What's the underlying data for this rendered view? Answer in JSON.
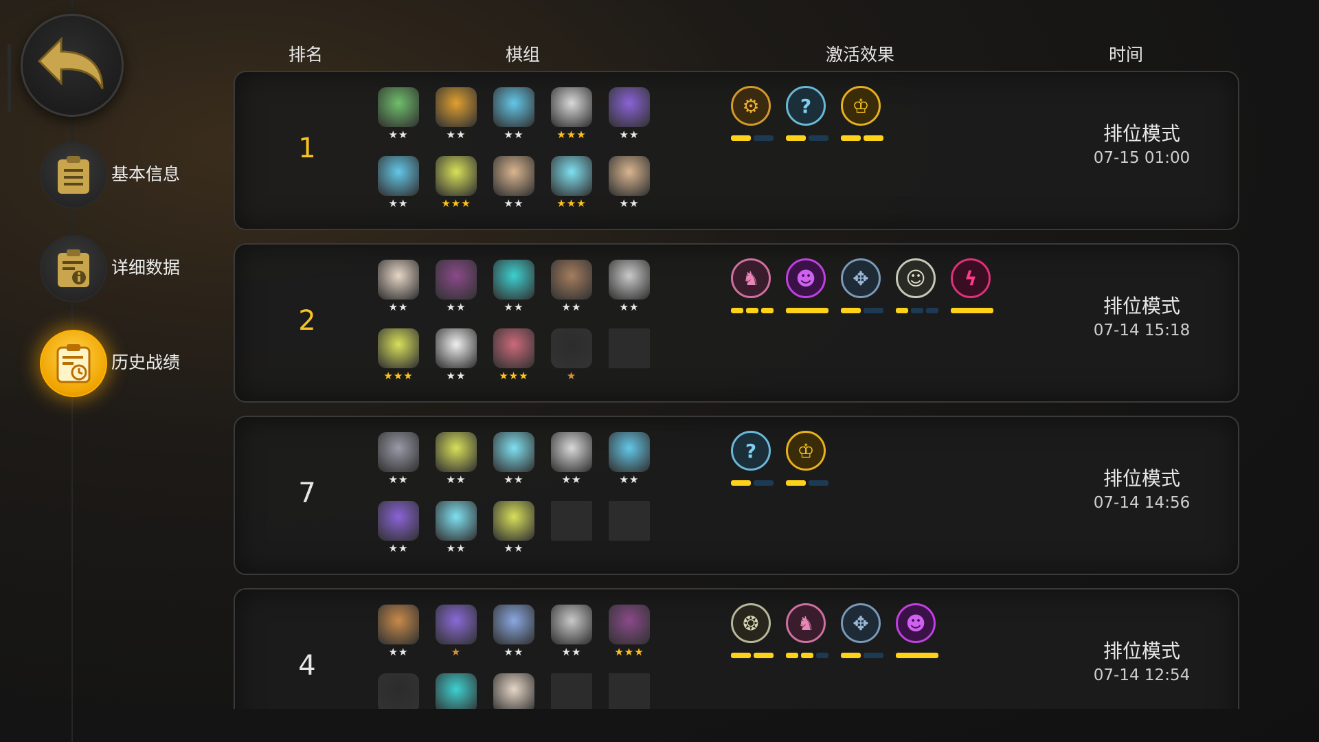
{
  "headers": {
    "rank": "排名",
    "team": "棋组",
    "effect": "激活效果",
    "time": "时间"
  },
  "nav": {
    "back_icon": "back-arrow-icon",
    "items": [
      {
        "label": "基本信息",
        "icon": "clipboard-list-icon",
        "active": false
      },
      {
        "label": "详细数据",
        "icon": "clipboard-info-icon",
        "active": false
      },
      {
        "label": "历史战绩",
        "icon": "clipboard-clock-icon",
        "active": true
      }
    ]
  },
  "rows": [
    {
      "rank": "1",
      "mode": "排位模式",
      "date": "07-15 01:00",
      "units": [
        {
          "color": "#6fbf6a",
          "stars": "★★",
          "tone": "s"
        },
        {
          "color": "#e0a030",
          "stars": "★★",
          "tone": "s"
        },
        {
          "color": "#63c7e8",
          "stars": "★★",
          "tone": "s"
        },
        {
          "color": "#d9d9d9",
          "stars": "★★★",
          "tone": "g"
        },
        {
          "color": "#8a63d8",
          "stars": "★★",
          "tone": "s"
        },
        {
          "color": "#63c7e8",
          "stars": "★★",
          "tone": "s"
        },
        {
          "color": "#d8e05a",
          "stars": "★★★",
          "tone": "g"
        },
        {
          "color": "#d9b58f",
          "stars": "★★",
          "tone": "s"
        },
        {
          "color": "#7fe0f0",
          "stars": "★★★",
          "tone": "g"
        },
        {
          "color": "#d9b58f",
          "stars": "★★",
          "tone": "s"
        }
      ],
      "effects": [
        {
          "glyph": "⚙",
          "ring": "#d39b2a",
          "fill": "#3a2a10",
          "text": "#f0b030",
          "bars": [
            1,
            0
          ]
        },
        {
          "glyph": "?",
          "ring": "#6ab8d8",
          "fill": "#1b2f3a",
          "text": "#7fd0f0",
          "bars": [
            1,
            0
          ]
        },
        {
          "glyph": "♔",
          "ring": "#e8b020",
          "fill": "#3a2c08",
          "text": "#ffcc20",
          "bars": [
            1,
            1
          ]
        }
      ]
    },
    {
      "rank": "2",
      "mode": "排位模式",
      "date": "07-14 15:18",
      "units": [
        {
          "color": "#e6d6c6",
          "stars": "★★",
          "tone": "s"
        },
        {
          "color": "#8a4a8a",
          "stars": "★★",
          "tone": "s"
        },
        {
          "color": "#3ed0d0",
          "stars": "★★",
          "tone": "s"
        },
        {
          "color": "#a57d5e",
          "stars": "★★",
          "tone": "s"
        },
        {
          "color": "#c9c9c9",
          "stars": "★★",
          "tone": "s"
        },
        {
          "color": "#d8e05a",
          "stars": "★★★",
          "tone": "g"
        },
        {
          "color": "#efefef",
          "stars": "★★",
          "tone": "s"
        },
        {
          "color": "#cc6a7a",
          "stars": "★★★",
          "tone": "g"
        },
        {
          "color": "#2c2c2c",
          "stars": "★",
          "tone": "o"
        },
        {
          "color": "",
          "stars": "",
          "tone": "s",
          "empty": true
        }
      ],
      "effects": [
        {
          "glyph": "♞",
          "ring": "#d070a0",
          "fill": "#3a1d2c",
          "text": "#e888b8",
          "bars": [
            1,
            1,
            1
          ]
        },
        {
          "glyph": "☻",
          "ring": "#c040e0",
          "fill": "#3a1248",
          "text": "#d060f0",
          "bars": [
            1
          ]
        },
        {
          "glyph": "✥",
          "ring": "#7a9ab8",
          "fill": "#1e2a36",
          "text": "#9ab8d8",
          "bars": [
            1,
            0
          ]
        },
        {
          "glyph": "☺",
          "ring": "#c8c8b8",
          "fill": "#2a2a24",
          "text": "#e0e0d0",
          "bars": [
            1,
            0,
            0
          ]
        },
        {
          "glyph": "ϟ",
          "ring": "#e0307a",
          "fill": "#3a0e22",
          "text": "#ff3a8a",
          "bars": [
            1
          ]
        }
      ]
    },
    {
      "rank": "7",
      "mode": "排位模式",
      "date": "07-14 14:56",
      "units": [
        {
          "color": "#9a9aa8",
          "stars": "★★",
          "tone": "s"
        },
        {
          "color": "#d8e05a",
          "stars": "★★",
          "tone": "s"
        },
        {
          "color": "#7fe0f0",
          "stars": "★★",
          "tone": "s"
        },
        {
          "color": "#d9d9d9",
          "stars": "★★",
          "tone": "s"
        },
        {
          "color": "#63c7e8",
          "stars": "★★",
          "tone": "s"
        },
        {
          "color": "#8a63d8",
          "stars": "★★",
          "tone": "s"
        },
        {
          "color": "#7fe0f0",
          "stars": "★★",
          "tone": "s"
        },
        {
          "color": "#d8e05a",
          "stars": "★★",
          "tone": "s"
        },
        {
          "color": "",
          "stars": "",
          "tone": "s",
          "empty": true
        },
        {
          "color": "",
          "stars": "",
          "tone": "s",
          "empty": true
        }
      ],
      "effects": [
        {
          "glyph": "?",
          "ring": "#6ab8d8",
          "fill": "#1b2f3a",
          "text": "#7fd0f0",
          "bars": [
            1,
            0
          ]
        },
        {
          "glyph": "♔",
          "ring": "#e8b020",
          "fill": "#3a2c08",
          "text": "#ffcc20",
          "bars": [
            1,
            0
          ]
        }
      ]
    },
    {
      "rank": "4",
      "mode": "排位模式",
      "date": "07-14 12:54",
      "units": [
        {
          "color": "#c98a4a",
          "stars": "★★",
          "tone": "s"
        },
        {
          "color": "#8a6ad8",
          "stars": "★",
          "tone": "o"
        },
        {
          "color": "#8aa8e0",
          "stars": "★★",
          "tone": "s"
        },
        {
          "color": "#c9c9c9",
          "stars": "★★",
          "tone": "s"
        },
        {
          "color": "#8a4a8a",
          "stars": "★★★",
          "tone": "g"
        },
        {
          "color": "#2c2c2c",
          "stars": "",
          "tone": "s"
        },
        {
          "color": "#3ed0d0",
          "stars": "",
          "tone": "s"
        },
        {
          "color": "#e6d6c6",
          "stars": "",
          "tone": "s"
        },
        {
          "color": "",
          "stars": "",
          "tone": "s",
          "empty": true
        },
        {
          "color": "",
          "stars": "",
          "tone": "s",
          "empty": true
        }
      ],
      "effects": [
        {
          "glyph": "❂",
          "ring": "#b8b898",
          "fill": "#26261c",
          "text": "#d8d8b0",
          "bars": [
            1,
            1
          ]
        },
        {
          "glyph": "♞",
          "ring": "#d070a0",
          "fill": "#3a1d2c",
          "text": "#e888b8",
          "bars": [
            1,
            1,
            0
          ]
        },
        {
          "glyph": "✥",
          "ring": "#7a9ab8",
          "fill": "#1e2a36",
          "text": "#9ab8d8",
          "bars": [
            1,
            0
          ]
        },
        {
          "glyph": "☻",
          "ring": "#c040e0",
          "fill": "#3a1248",
          "text": "#d060f0",
          "bars": [
            1
          ]
        }
      ]
    }
  ]
}
